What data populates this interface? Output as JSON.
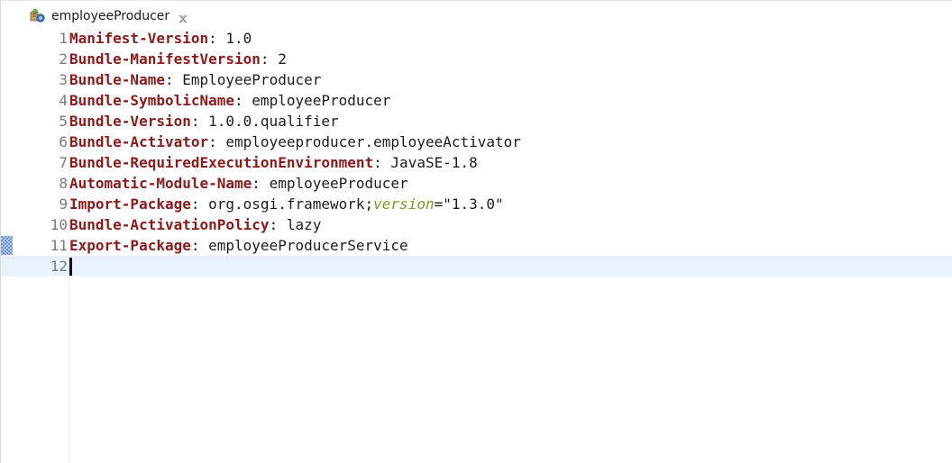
{
  "tab": {
    "title": "employeeProducer",
    "icon": "manifest-file-icon",
    "close_icon": "close-icon"
  },
  "editor": {
    "lines": [
      {
        "number": "1",
        "key": "Manifest-Version",
        "sep": ": ",
        "value": "1.0"
      },
      {
        "number": "2",
        "key": "Bundle-ManifestVersion",
        "sep": ": ",
        "value": "2"
      },
      {
        "number": "3",
        "key": "Bundle-Name",
        "sep": ": ",
        "value": "EmployeeProducer"
      },
      {
        "number": "4",
        "key": "Bundle-SymbolicName",
        "sep": ": ",
        "value": "employeeProducer"
      },
      {
        "number": "5",
        "key": "Bundle-Version",
        "sep": ": ",
        "value": "1.0.0.qualifier"
      },
      {
        "number": "6",
        "key": "Bundle-Activator",
        "sep": ": ",
        "value": "employeeproducer.employeeActivator"
      },
      {
        "number": "7",
        "key": "Bundle-RequiredExecutionEnvironment",
        "sep": ": ",
        "value": "JavaSE-1.8"
      },
      {
        "number": "8",
        "key": "Automatic-Module-Name",
        "sep": ": ",
        "value": "employeeProducer"
      },
      {
        "number": "9",
        "key": "Import-Package",
        "sep": ": ",
        "value": "org.osgi.framework;",
        "attr": "version",
        "attr_value": "=\"1.3.0\""
      },
      {
        "number": "10",
        "key": "Bundle-ActivationPolicy",
        "sep": ": ",
        "value": "lazy"
      },
      {
        "number": "11",
        "key": "Export-Package",
        "sep": ": ",
        "value": "employeeProducerService"
      },
      {
        "number": "12",
        "key": "",
        "sep": "",
        "value": ""
      }
    ],
    "current_line": 12,
    "marked_line": 11
  },
  "colors": {
    "key": "#8b1a1a",
    "attribute": "#7e9a22",
    "current_line_bg": "#e8f2fe",
    "line_number": "#7a7a7a"
  }
}
